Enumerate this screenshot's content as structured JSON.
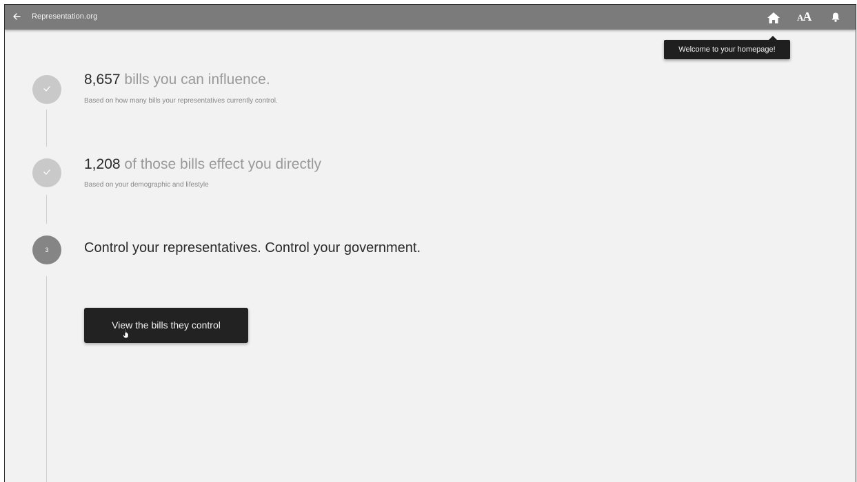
{
  "topbar": {
    "site_title": "Representation.org",
    "icons": [
      "back-arrow-icon",
      "home-icon",
      "font-size-icon",
      "bell-icon"
    ],
    "font_icon_glyphs": {
      "small": "A",
      "big": "A"
    }
  },
  "tooltip": {
    "text": "Welcome to your homepage!"
  },
  "steps": [
    {
      "state": "done",
      "number": "8,657",
      "title": " bills you can influence.",
      "subtitle": "Based on how many bills your representatives currently control."
    },
    {
      "state": "done",
      "number": "1,208",
      "title": " of those bills effect you directly",
      "subtitle": "Based on your demographic and lifestyle"
    },
    {
      "state": "current",
      "badge": "3",
      "title": "Control your representatives. Control your government."
    }
  ],
  "cta": {
    "label": "View the bills they control"
  },
  "colors": {
    "topbar": "#7b7b7b",
    "background": "#f2f2f2",
    "step_done": "#c9c9c9",
    "step_current": "#858585",
    "button": "#222222",
    "tooltip": "#1f1f1f"
  }
}
